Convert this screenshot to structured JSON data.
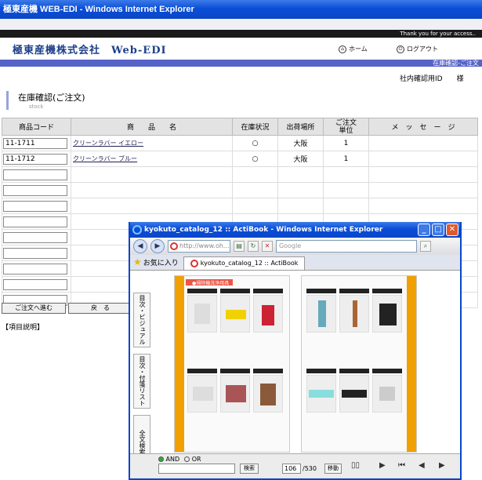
{
  "window": {
    "title": "極東産機 WEB-EDI - Windows Internet Explorer"
  },
  "topbar": {
    "thanks": "Thank you for your access.."
  },
  "header": {
    "logo": "極東産機株式会社　Web-EDI",
    "home": "ホーム",
    "logout": "ログアウト"
  },
  "section_strip": "在庫確認-ご注文",
  "user_label": "社内確認用ID　　様",
  "page": {
    "title": "在庫確認(ご注文)",
    "subtitle": "stock"
  },
  "table": {
    "headers": [
      "商品コード",
      "商　　品　　名",
      "在庫状況",
      "出荷場所",
      "ご注文\n単位",
      "メ　ッ　セ　ー　ジ"
    ],
    "rows": [
      {
        "code": "11-1711",
        "name": "クリーンラバー イエロー",
        "status": "○",
        "place": "大阪",
        "unit": "1",
        "msg": ""
      },
      {
        "code": "11-1712",
        "name": "クリーンラバー ブルー",
        "status": "○",
        "place": "大阪",
        "unit": "1",
        "msg": ""
      }
    ],
    "empty_rows": 9
  },
  "buttons": {
    "order": "ご注文へ進む",
    "back": "戻　る"
  },
  "explain": "【項目説明】",
  "popup": {
    "title": "kyokuto_catalog_12 :: ActiBook - Windows Internet Explorer",
    "address": "http://www.oh...",
    "search_placeholder": "Google",
    "favorites": "お気に入り",
    "tab": "kyokuto_catalog_12 :: ActiBook",
    "sidetabs": [
      "目次・ビジュアル",
      "目次・付箋リスト",
      "全文検索"
    ],
    "page_header": "●掃除機洗浄用具",
    "and_label": "AND",
    "or_label": "OR",
    "search_btn": "検索",
    "page_input": "106",
    "page_total": "/530",
    "move_btn": "移動"
  }
}
